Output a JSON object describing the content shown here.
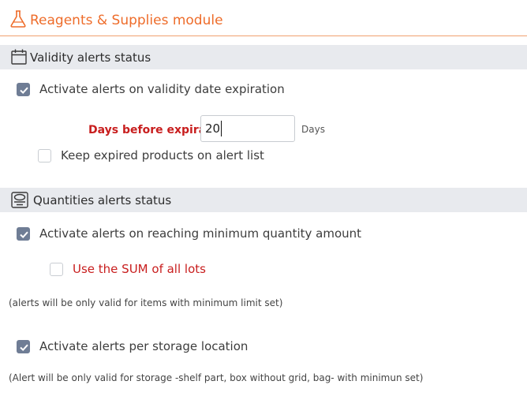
{
  "module": {
    "title": "Reagents & Supplies module",
    "accent": "#ee6c2a"
  },
  "validity": {
    "section_title": "Validity alerts status",
    "activate_label": "Activate alerts on validity date expiration",
    "activate_checked": true,
    "days_label": "Days before expiration:",
    "days_value": "20",
    "days_unit": "Days",
    "keep_expired_label": "Keep expired products on alert list",
    "keep_expired_checked": false
  },
  "quantities": {
    "section_title": "Quantities alerts status",
    "activate_label": "Activate alerts on reaching minimum quantity amount",
    "activate_checked": true,
    "sum_label": "Use the SUM of all lots",
    "sum_checked": false,
    "note": "(alerts will be only valid for items with minimum limit set)",
    "storage_label": "Activate alerts per storage location",
    "storage_checked": true,
    "storage_note": "(Alert will be only valid for storage -shelf part, box without grid, bag- with minimun set)"
  }
}
